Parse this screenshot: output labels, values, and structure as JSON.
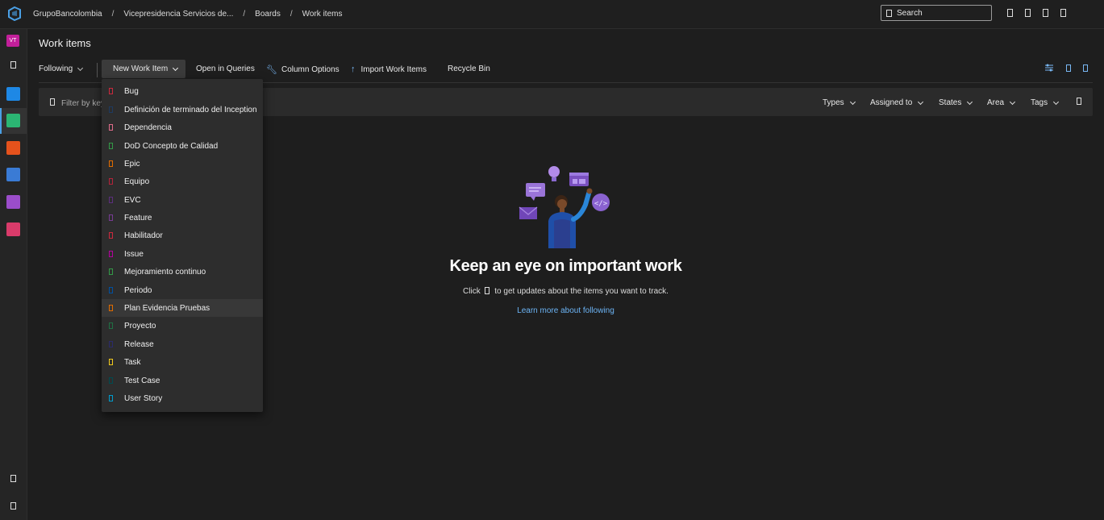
{
  "header": {
    "breadcrumbs": [
      "GrupoBancolombia",
      "Vicepresidencia Servicios de...",
      "Boards",
      "Work items"
    ],
    "search_label": "Search"
  },
  "leftnav": {
    "avatar_initials": "VT",
    "apps": [
      {
        "name": "overview",
        "color": "#1e88e5"
      },
      {
        "name": "boards",
        "color": "#2bb673"
      },
      {
        "name": "repos",
        "color": "#e5521c"
      },
      {
        "name": "pipelines",
        "color": "#3a7bd5"
      },
      {
        "name": "test-plans",
        "color": "#9b4dca"
      },
      {
        "name": "artifacts",
        "color": "#d93b6a"
      }
    ]
  },
  "page": {
    "title": "Work items"
  },
  "toolbar": {
    "following": "Following",
    "new_work_item": "New Work Item",
    "open_in_queries": "Open in Queries",
    "column_options": "Column Options",
    "import_work_items": "Import Work Items",
    "recycle_bin": "Recycle Bin"
  },
  "filter": {
    "placeholder": "Filter by key",
    "types": "Types",
    "assigned_to": "Assigned to",
    "states": "States",
    "area": "Area",
    "tags": "Tags"
  },
  "empty_state": {
    "title": "Keep an eye on important work",
    "line_before": "Click",
    "line_after": "to get updates about the items you want to track.",
    "link": "Learn more about following"
  },
  "menu": {
    "items": [
      {
        "label": "Bug",
        "color": "#cc293d"
      },
      {
        "label": "Definición de terminado del Inception",
        "color": "#1e3a5f"
      },
      {
        "label": "Dependencia",
        "color": "#e06c8a"
      },
      {
        "label": "DoD Concepto de Calidad",
        "color": "#339947"
      },
      {
        "label": "Epic",
        "color": "#e06c00"
      },
      {
        "label": "Equipo",
        "color": "#b4233a"
      },
      {
        "label": "EVC",
        "color": "#5c2e7e"
      },
      {
        "label": "Feature",
        "color": "#773b93"
      },
      {
        "label": "Habilitador",
        "color": "#cc293d"
      },
      {
        "label": "Issue",
        "color": "#b4009e"
      },
      {
        "label": "Mejoramiento continuo",
        "color": "#339947"
      },
      {
        "label": "Periodo",
        "color": "#0050a0"
      },
      {
        "label": "Plan Evidencia Pruebas",
        "color": "#e06c00"
      },
      {
        "label": "Proyecto",
        "color": "#1f6f43"
      },
      {
        "label": "Release",
        "color": "#2b2b6b"
      },
      {
        "label": "Task",
        "color": "#f2cb1d"
      },
      {
        "label": "Test Case",
        "color": "#004b50"
      },
      {
        "label": "User Story",
        "color": "#009ccc"
      }
    ],
    "highlighted_index": 12
  }
}
